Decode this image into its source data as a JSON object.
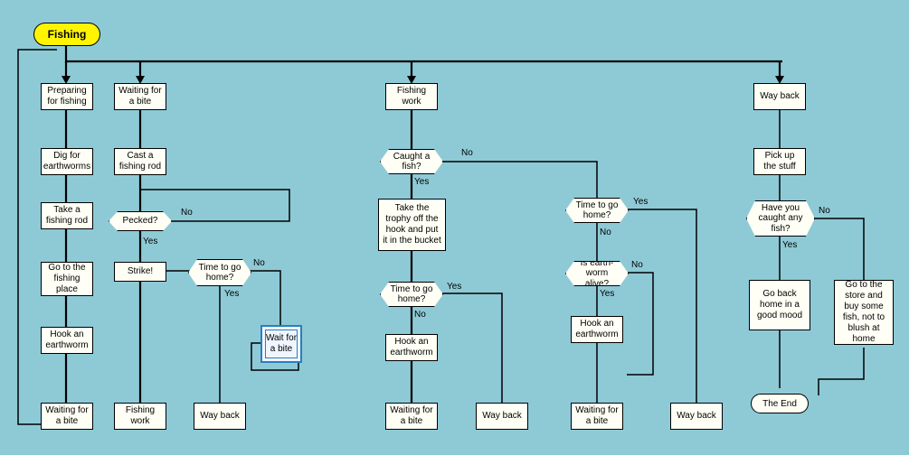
{
  "title": "Fishing",
  "col1": {
    "n1": "Preparing for fishing",
    "n2": "Dig for earthworms",
    "n3": "Take a fishing rod",
    "n4": "Go to the fishing place",
    "n5": "Hook an earthworm",
    "n6": "Waiting for a bite"
  },
  "col2": {
    "n1": "Waiting for a bite",
    "n2": "Cast a fishing rod",
    "d1": "Pecked?",
    "n3": "Strike!",
    "n4": "Fishing work"
  },
  "col3": {
    "d1": "Time to go home?",
    "call": "Wait for a bite",
    "n1": "Way back"
  },
  "col4": {
    "n1": "Fishing work",
    "d1": "Caught a fish?",
    "n2": "Take the trophy off the hook and put it in the bucket",
    "d2": "Time to go home?",
    "n3": "Hook an earthworm",
    "n4": "Waiting for a bite"
  },
  "col5": {
    "n1": "Way back"
  },
  "col6": {
    "d1": "Time to go home?",
    "d2": "Is earth-\nworm alive?",
    "n1": "Hook an earthworm",
    "n2": "Waiting for a bite"
  },
  "col7": {
    "n1": "Way back"
  },
  "col8": {
    "n1": "Way back",
    "n2": "Pick up the stuff",
    "d1": "Have you caught any fish?",
    "n3": "Go back home in a good mood",
    "end": "The End"
  },
  "col9": {
    "n1": "Go to the store and buy some fish, not to blush at home"
  },
  "labels": {
    "yes": "Yes",
    "no": "No"
  }
}
